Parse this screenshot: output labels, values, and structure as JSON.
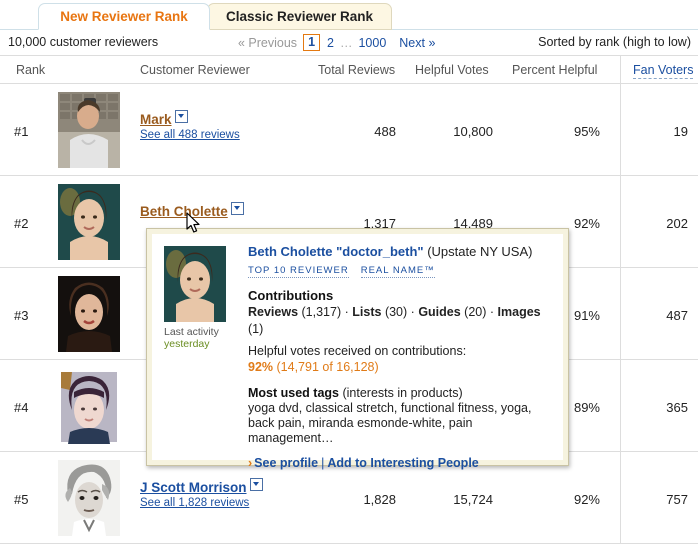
{
  "tabs": [
    {
      "label": "New Reviewer Rank",
      "active": true
    },
    {
      "label": "Classic Reviewer Rank",
      "active": false
    }
  ],
  "infobar": {
    "count_text": "10,000 customer reviewers",
    "sort_text": "Sorted by rank (high to low)",
    "pager": {
      "previous": "« Previous",
      "current": "1",
      "page2": "2",
      "ellipsis": "…",
      "last": "1000",
      "next": "Next »"
    }
  },
  "table": {
    "headers": {
      "rank": "Rank",
      "reviewer": "Customer Reviewer",
      "total_reviews": "Total Reviews",
      "helpful_votes": "Helpful Votes",
      "percent_helpful": "Percent Helpful",
      "fan_voters": "Fan Voters"
    },
    "rows": [
      {
        "rank": "#1",
        "name": "Mark",
        "name_visited": true,
        "see_all": "See all 488 reviews",
        "total_reviews": "488",
        "helpful_votes": "10,800",
        "percent_helpful": "95%",
        "fan_voters": "19"
      },
      {
        "rank": "#2",
        "name": "Beth Cholette",
        "name_visited": true,
        "see_all": "",
        "total_reviews": "1,317",
        "helpful_votes": "14,489",
        "percent_helpful": "92%",
        "fan_voters": "202"
      },
      {
        "rank": "#3",
        "name": "",
        "name_visited": false,
        "see_all": "",
        "total_reviews": "",
        "helpful_votes": "",
        "percent_helpful": "91%",
        "fan_voters": "487"
      },
      {
        "rank": "#4",
        "name": "",
        "name_visited": false,
        "see_all": "",
        "total_reviews": "",
        "helpful_votes": "",
        "percent_helpful": "89%",
        "fan_voters": "365"
      },
      {
        "rank": "#5",
        "name": "J Scott Morrison",
        "name_visited": false,
        "see_all": "See all 1,828 reviews",
        "total_reviews": "1,828",
        "helpful_votes": "15,724",
        "percent_helpful": "92%",
        "fan_voters": "757"
      }
    ]
  },
  "popup": {
    "name": "Beth Cholette",
    "nickname": "\"doctor_beth\"",
    "location": "(Upstate NY USA)",
    "badges": [
      "TOP 10 REVIEWER",
      "REAL NAME™"
    ],
    "last_activity_label": "Last activity",
    "last_activity_value": "yesterday",
    "contributions_heading": "Contributions",
    "contributions_line": "Reviews (1,317) · Lists (30) · Guides (20) · Images (1)",
    "contrib_reviews_label": "Reviews",
    "contrib_reviews_count": "(1,317)",
    "contrib_lists_label": "Lists",
    "contrib_lists_count": "(30)",
    "contrib_guides_label": "Guides",
    "contrib_guides_count": "(20)",
    "contrib_images_label": "Images",
    "contrib_images_count": "(1)",
    "helpful_votes_label": "Helpful votes received on contributions:",
    "helpful_votes_percent": "92%",
    "helpful_votes_detail": "(14,791 of 16,128)",
    "tags_heading": "Most used tags",
    "tags_subheading": "(interests in products)",
    "tags_list": "yoga dvd, classical stretch, functional fitness, yoga, back pain, miranda esmonde-white, pain management…",
    "see_profile": "See profile",
    "separator": "|",
    "add_interesting": "Add to Interesting People"
  },
  "colors": {
    "accent_orange": "#e87511",
    "link_blue": "#1b4fa0",
    "visited_brown": "#9a5b1e",
    "popup_border": "#c9c3a4",
    "popup_bg": "#f6f3df"
  }
}
